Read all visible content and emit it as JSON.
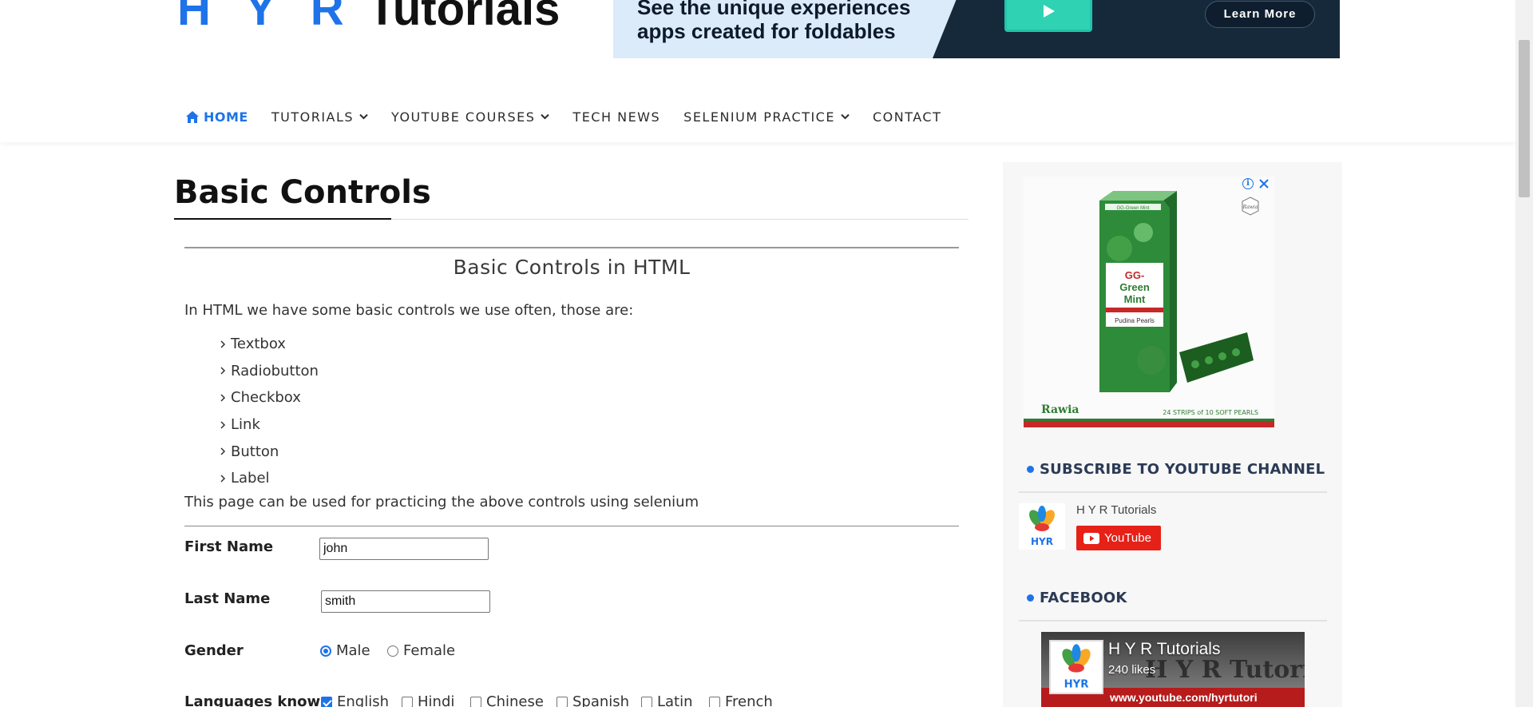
{
  "header": {
    "logo_hyr": "H Y R",
    "logo_tutorials": "Tutorials",
    "banner": {
      "line1": "See the unique experiences",
      "line2": "apps created for foldables",
      "cta": "Learn More"
    }
  },
  "nav": {
    "home": "HOME",
    "tutorials": "TUTORIALS",
    "youtube_courses": "YOUTUBE COURSES",
    "tech_news": "TECH NEWS",
    "selenium_practice": "SELENIUM PRACTICE",
    "contact": "CONTACT"
  },
  "main": {
    "page_title": "Basic Controls",
    "section_title": "Basic Controls in HTML",
    "intro": "In HTML we have some basic controls we use often, those are:",
    "controls": [
      "Textbox",
      "Radiobutton",
      "Checkbox",
      "Link",
      "Button",
      "Label"
    ],
    "outro": "This page can be used for practicing the above controls using selenium"
  },
  "form": {
    "first_name_label": "First Name",
    "first_name_value": "john",
    "last_name_label": "Last Name",
    "last_name_value": "smith",
    "gender_label": "Gender",
    "gender_options": [
      {
        "label": "Male",
        "selected": true
      },
      {
        "label": "Female",
        "selected": false
      }
    ],
    "languages_label": "Languages known",
    "languages": [
      {
        "label": "English",
        "checked": true
      },
      {
        "label": "Hindi",
        "checked": false
      },
      {
        "label": "Chinese",
        "checked": false
      },
      {
        "label": "Spanish",
        "checked": false
      },
      {
        "label": "Latin",
        "checked": false
      },
      {
        "label": "French",
        "checked": false
      }
    ]
  },
  "sidebar": {
    "ad": {
      "product_line1": "GG-",
      "product_line2": "Green",
      "product_line3": "Mint",
      "product_sub": "Pudina Pearls",
      "box_top": "GG-Green Mint",
      "brand": "Rawia",
      "fine_print": "24 STRIPS of 10 SOFT PEARLS",
      "badge": "Rawia",
      "info_glyph": "i"
    },
    "subscribe": {
      "title": "SUBSCRIBE TO YOUTUBE CHANNEL",
      "channel_name": "H Y R Tutorials",
      "button": "YouTube"
    },
    "facebook": {
      "title": "FACEBOOK",
      "page_name": "H Y R Tutorials",
      "likes": "240 likes",
      "cover_text": "H Y R Tutoria",
      "cover_url": "www.youtube.com/hyrtutori"
    },
    "avatar_text": "HYR"
  },
  "colors": {
    "accent": "#1e73e8",
    "banner_bg": "#dcebfa",
    "banner_navy": "#16293b",
    "youtube_red": "#e62117"
  },
  "icons": {
    "home": "home-icon",
    "chevron": "chevron-down-icon",
    "list_arrow": "chevron-right-icon",
    "ad_info": "info-icon",
    "ad_close": "close-icon",
    "youtube": "youtube-play-icon"
  }
}
